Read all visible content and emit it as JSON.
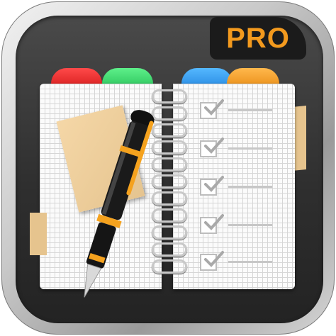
{
  "app_icon": {
    "badge_text": "PRO",
    "accent_color": "#f39a1e",
    "tabs": [
      "red-tab",
      "green-tab",
      "blue-tab",
      "orange-tab"
    ],
    "checklist_rows": 5,
    "icons": [
      "notebook-icon",
      "pen-icon",
      "sticky-note-icon",
      "checkbox-icon"
    ]
  }
}
